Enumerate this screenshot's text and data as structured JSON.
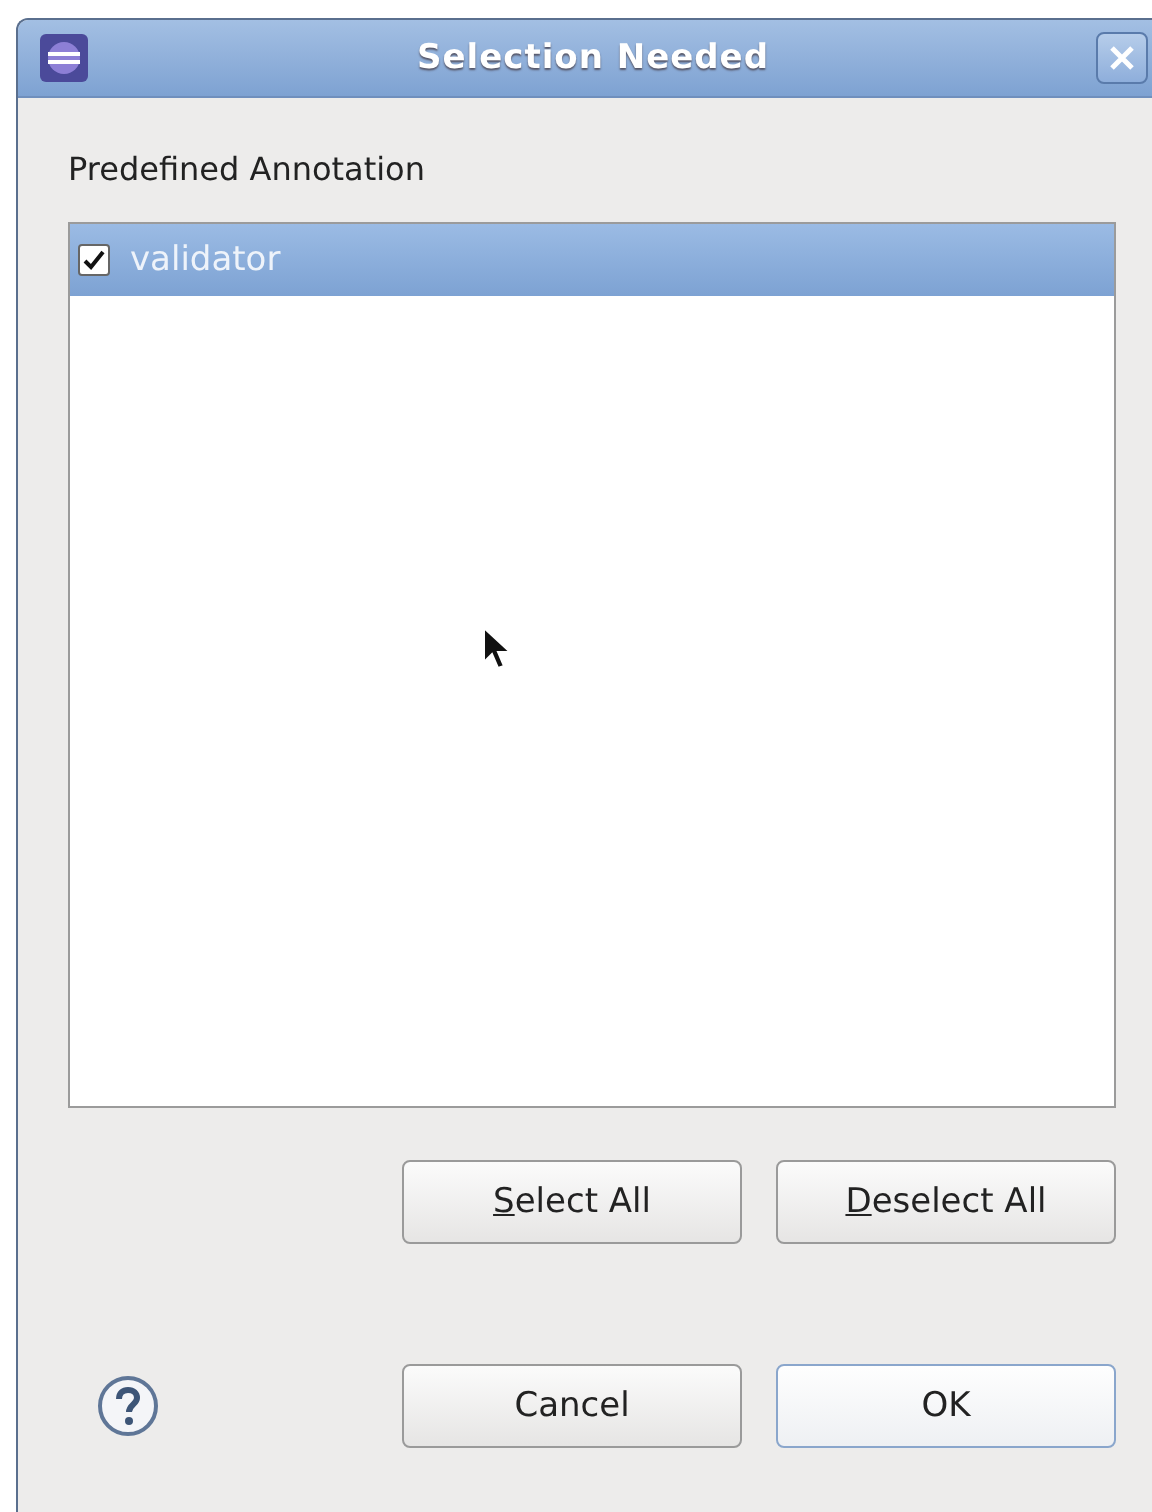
{
  "window": {
    "title": "Selection Needed"
  },
  "label": "Predefined Annotation",
  "items": [
    {
      "label": "validator",
      "checked": true,
      "selected": true
    }
  ],
  "list_buttons": [
    {
      "label": "Select All",
      "mnemonic": true
    },
    {
      "label": "Deselect All",
      "mnemonic": true
    }
  ],
  "buttons": [
    {
      "label": "Cancel",
      "default": false
    },
    {
      "label": "OK",
      "default": true
    }
  ]
}
